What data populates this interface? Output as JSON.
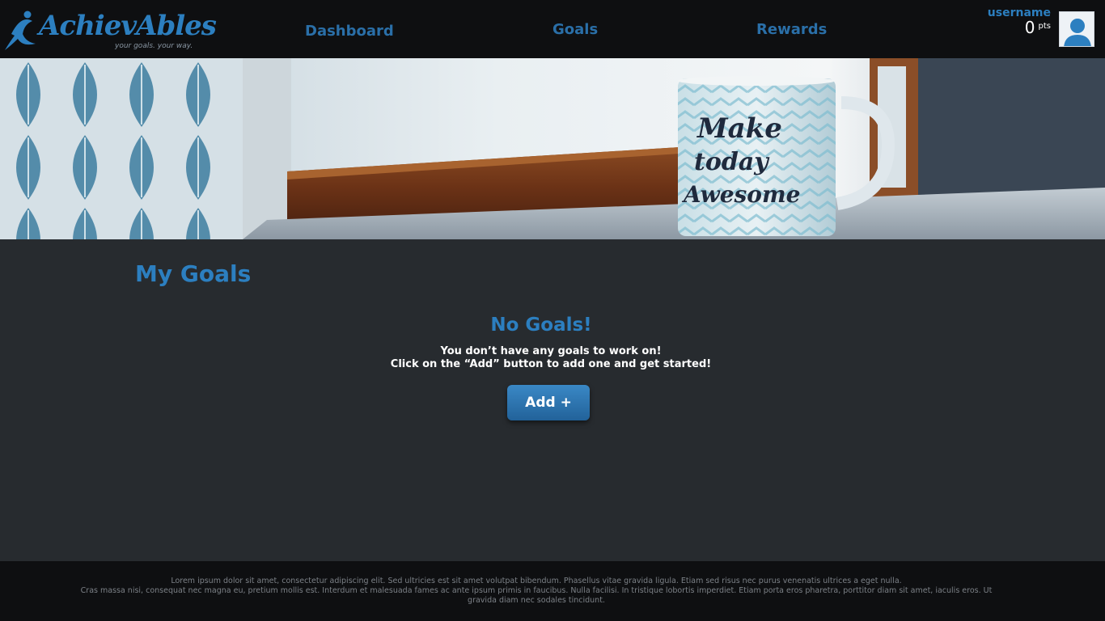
{
  "brand": {
    "name": "AchievAbles",
    "tagline": "your goals. your way."
  },
  "nav": {
    "dashboard": "Dashboard",
    "goals": "Goals",
    "rewards": "Rewards"
  },
  "user": {
    "name": "username",
    "points": "0",
    "points_unit": "pts"
  },
  "banner": {
    "mug_text": [
      "Make",
      "today",
      "Awesome"
    ]
  },
  "main": {
    "title": "My Goals",
    "empty_title": "No Goals!",
    "empty_line1": "You don’t have any goals to work on!",
    "empty_line2": "Click on the “Add” button to add one and get started!",
    "add_label": "Add +"
  },
  "footer": {
    "line1": "Lorem ipsum dolor sit amet, consectetur adipiscing elit. Sed ultricies est sit amet volutpat bibendum. Phasellus vitae gravida ligula. Etiam sed risus nec purus venenatis ultrices a eget nulla.",
    "line2": "Cras massa nisi, consequat nec magna eu, pretium mollis est. Interdum et malesuada fames ac ante ipsum primis in faucibus. Nulla facilisi. In tristique lobortis imperdiet. Etiam porta eros pharetra, porttitor diam sit amet, iaculis eros. Ut gravida diam nec sodales tincidunt."
  },
  "colors": {
    "accent": "#2c7fc0",
    "nav_text": "#2a6fa8",
    "header_bg": "#0e0f11",
    "page_bg": "#272b2f"
  },
  "icons": {
    "logo": "running-figure-icon",
    "avatar": "user-avatar-icon"
  }
}
